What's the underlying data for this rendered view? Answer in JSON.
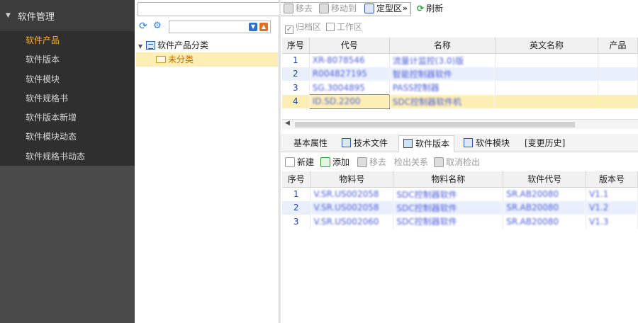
{
  "sidebar": {
    "title": "软件管理",
    "items": [
      {
        "label": "软件产品",
        "active": true
      },
      {
        "label": "软件版本"
      },
      {
        "label": "软件模块"
      },
      {
        "label": "软件规格书"
      },
      {
        "label": "软件版本新增"
      },
      {
        "label": "软件模块动态"
      },
      {
        "label": "软件规格书动态"
      }
    ]
  },
  "tree": {
    "root_label": "软件产品分类",
    "child_label": "未分类",
    "combo_value": "",
    "search_value": ""
  },
  "toolbar": {
    "move_out": "移去",
    "move_to": "移动到",
    "pick_area": "定型区",
    "refresh": "刷新",
    "archive_area": "归档区",
    "work_area": "工作区",
    "search_value": ""
  },
  "top_grid": {
    "columns": [
      "序号",
      "代号",
      "名称",
      "英文名称",
      "产品"
    ],
    "rows": [
      {
        "no": "1",
        "code": "XR-8078546",
        "name": "流量计监控(3.0)版"
      },
      {
        "no": "2",
        "code": "R004827195",
        "name": "智能控制器软件"
      },
      {
        "no": "3",
        "code": "SG.3004895",
        "name": "PASS控制器"
      },
      {
        "no": "4",
        "code": "ID.SD.2200",
        "name": "SDC控制器软件机"
      }
    ]
  },
  "tabs": [
    {
      "label": "基本属性",
      "active": false
    },
    {
      "label": "技术文件",
      "active": false
    },
    {
      "label": "软件版本",
      "active": true
    },
    {
      "label": "软件模块",
      "active": false
    },
    {
      "label": "[变更历史]",
      "active": false
    }
  ],
  "sub_toolbar": {
    "new": "新建",
    "add": "添加",
    "remove": "移去",
    "checkout_relation": "检出关系",
    "cancel_checkout": "取消检出"
  },
  "bottom_grid": {
    "columns": [
      "序号",
      "物料号",
      "物料名称",
      "软件代号",
      "版本号"
    ],
    "rows": [
      {
        "no": "1",
        "material_no": "V.SR.US002058",
        "material_name": "SDC控制器软件",
        "soft_code": "SR.AB20080",
        "version": "V1.1"
      },
      {
        "no": "2",
        "material_no": "V.SR.US002058",
        "material_name": "SDC控制器软件",
        "soft_code": "SR.AB20080",
        "version": "V1.2"
      },
      {
        "no": "3",
        "material_no": "V.SR.US002060",
        "material_name": "SDC控制器软件",
        "soft_code": "SR.AB20080",
        "version": "V1.3"
      }
    ]
  },
  "colors": {
    "sidebar_bg": "#4a4a4a",
    "active_nav": "#ffb020",
    "row_alt": "#e9effb",
    "row_selected": "#fdeeb4"
  }
}
